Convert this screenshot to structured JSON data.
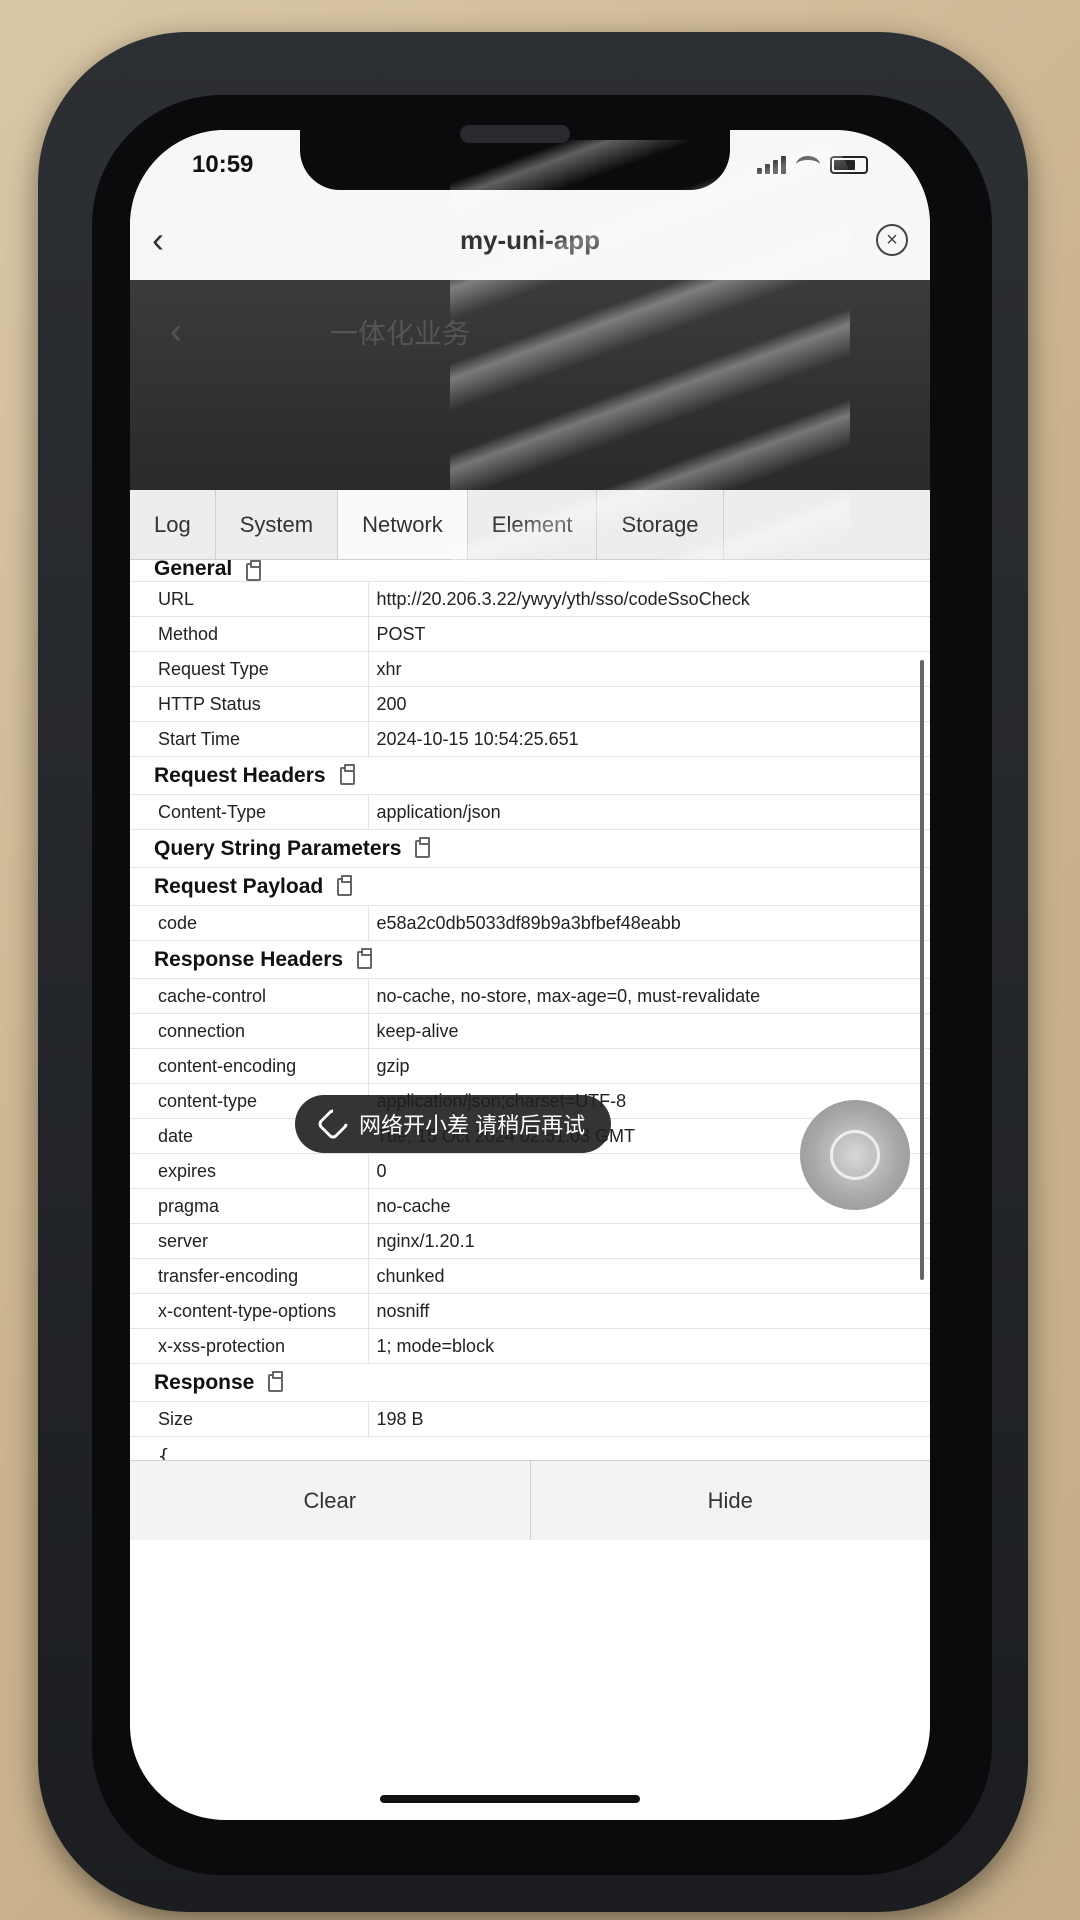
{
  "status_bar": {
    "time": "10:59"
  },
  "nav": {
    "title": "my-uni-app",
    "back": "‹",
    "close": "×"
  },
  "background_page": {
    "back": "‹",
    "title": "一体化业务"
  },
  "tabs": [
    {
      "label": "Log"
    },
    {
      "label": "System"
    },
    {
      "label": "Network"
    },
    {
      "label": "Element"
    },
    {
      "label": "Storage"
    }
  ],
  "general": {
    "title": "General",
    "rows": [
      {
        "key": "URL",
        "value": "http://20.206.3.22/ywyy/yth/sso/codeSsoCheck"
      },
      {
        "key": "Method",
        "value": "POST"
      },
      {
        "key": "Request Type",
        "value": "xhr"
      },
      {
        "key": "HTTP Status",
        "value": "200"
      },
      {
        "key": "Start Time",
        "value": "2024-10-15 10:54:25.651"
      }
    ]
  },
  "request_headers": {
    "title": "Request Headers",
    "rows": [
      {
        "key": "Content-Type",
        "value": "application/json"
      }
    ]
  },
  "query_params": {
    "title": "Query String Parameters"
  },
  "request_payload": {
    "title": "Request Payload",
    "rows": [
      {
        "key": "code",
        "value": "e58a2c0db5033df89b9a3bfbef48eabb"
      }
    ]
  },
  "response_headers": {
    "title": "Response Headers",
    "rows": [
      {
        "key": "cache-control",
        "value": "no-cache, no-store, max-age=0, must-revalidate"
      },
      {
        "key": "connection",
        "value": "keep-alive"
      },
      {
        "key": "content-encoding",
        "value": "gzip"
      },
      {
        "key": "content-type",
        "value": "application/json;charset=UTF-8"
      },
      {
        "key": "date",
        "value": "Tue, 15 Oct 2024 02:51:03 GMT"
      },
      {
        "key": "expires",
        "value": "0"
      },
      {
        "key": "pragma",
        "value": "no-cache"
      },
      {
        "key": "server",
        "value": "nginx/1.20.1"
      },
      {
        "key": "transfer-encoding",
        "value": "chunked"
      },
      {
        "key": "x-content-type-options",
        "value": "nosniff"
      },
      {
        "key": "x-xss-protection",
        "value": "1; mode=block"
      }
    ]
  },
  "response": {
    "title": "Response",
    "rows": [
      {
        "key": "Size",
        "value": "198 B"
      }
    ],
    "body": "{\n  \"msg\": \"Required request body is missing: public"
  },
  "toast": {
    "text": "网络开小差 请稍后再试"
  },
  "toolbar": {
    "clear": "Clear",
    "hide": "Hide"
  },
  "colors": {
    "toast_bg": "#1e1e1e",
    "tab_bar_bg": "#ededed",
    "nav_bg": "#f7f7f7"
  },
  "icons": [
    "back-arrow-icon",
    "close-circle-icon",
    "copy-icon",
    "broken-link-icon",
    "signal-icon",
    "wifi-icon",
    "battery-icon"
  ]
}
